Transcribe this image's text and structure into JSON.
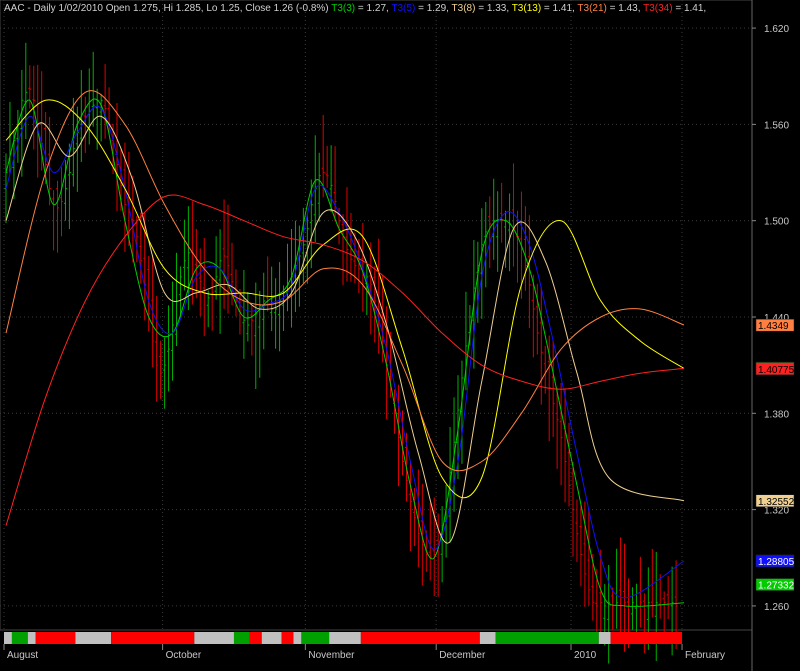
{
  "chart_data": {
    "type": "line",
    "title": {
      "prefix": "AAC - Daily 1/02/2010 Open 1.275, Hi 1.285, Lo 1.25, Close 1.26 (-0.8%)",
      "items": [
        {
          "label": "T3(3)",
          "value": "= 1.27",
          "color": "#00cc00"
        },
        {
          "label": "T3(5)",
          "value": "= 1.29",
          "color": "#1010ff"
        },
        {
          "label": "T3(8)",
          "value": "= 1.33",
          "color": "#f0d090"
        },
        {
          "label": "T3(13)",
          "value": "= 1.41",
          "color": "#ffff00"
        },
        {
          "label": "T3(21)",
          "value": "= 1.43",
          "color": "#ff8040"
        },
        {
          "label": "T3(34)",
          "value": "= 1.41",
          "color": "#ff2020"
        }
      ]
    },
    "ylim": [
      1.245,
      1.635
    ],
    "y_ticks": [
      "1.620",
      "1.560",
      "1.500",
      "1.440",
      "1.380",
      "1.320",
      "1.260"
    ],
    "x_months": [
      {
        "label": "August",
        "bar": 0
      },
      {
        "label": "October",
        "bar": 40
      },
      {
        "label": "November",
        "bar": 76
      },
      {
        "label": "December",
        "bar": 109
      },
      {
        "label": "2010",
        "bar": 143
      },
      {
        "label": "February",
        "bar": 171
      }
    ],
    "bar_count": 172,
    "close": [
      1.53,
      1.542,
      1.55,
      1.56,
      1.575,
      1.58,
      1.582,
      1.575,
      1.56,
      1.548,
      1.535,
      1.52,
      1.51,
      1.508,
      1.512,
      1.52,
      1.53,
      1.545,
      1.555,
      1.56,
      1.565,
      1.568,
      1.572,
      1.575,
      1.575,
      1.57,
      1.56,
      1.548,
      1.535,
      1.522,
      1.51,
      1.505,
      1.5,
      1.49,
      1.475,
      1.46,
      1.442,
      1.425,
      1.41,
      1.405,
      1.41,
      1.42,
      1.435,
      1.45,
      1.465,
      1.475,
      1.48,
      1.48,
      1.472,
      1.462,
      1.455,
      1.452,
      1.455,
      1.465,
      1.475,
      1.478,
      1.472,
      1.462,
      1.45,
      1.443,
      1.438,
      1.435,
      1.438,
      1.442,
      1.447,
      1.45,
      1.448,
      1.445,
      1.445,
      1.45,
      1.455,
      1.46,
      1.465,
      1.472,
      1.478,
      1.485,
      1.495,
      1.51,
      1.52,
      1.528,
      1.53,
      1.528,
      1.522,
      1.512,
      1.5,
      1.49,
      1.482,
      1.476,
      1.472,
      1.47,
      1.468,
      1.465,
      1.46,
      1.45,
      1.438,
      1.425,
      1.41,
      1.395,
      1.38,
      1.365,
      1.35,
      1.338,
      1.325,
      1.315,
      1.305,
      1.298,
      1.292,
      1.29,
      1.292,
      1.298,
      1.31,
      1.325,
      1.343,
      1.362,
      1.382,
      1.402,
      1.422,
      1.44,
      1.458,
      1.472,
      1.485,
      1.493,
      1.498,
      1.5,
      1.5,
      1.5,
      1.5,
      1.498,
      1.495,
      1.49,
      1.482,
      1.472,
      1.46,
      1.445,
      1.43,
      1.418,
      1.406,
      1.396,
      1.386,
      1.376,
      1.365,
      1.35,
      1.335,
      1.32,
      1.305,
      1.292,
      1.28,
      1.27,
      1.262,
      1.26,
      1.262,
      1.26,
      1.262,
      1.26,
      1.262,
      1.26,
      1.262,
      1.26,
      1.262,
      1.26,
      1.262,
      1.26,
      1.262,
      1.26,
      1.262,
      1.26,
      1.262,
      1.26,
      1.262,
      1.26
    ],
    "series": [
      {
        "name": "T3(3)",
        "color": "#00cc00",
        "last_value": "1.27332",
        "values": [
          [
            0,
            1.53
          ],
          [
            6,
            1.575
          ],
          [
            12,
            1.51
          ],
          [
            18,
            1.56
          ],
          [
            24,
            1.572
          ],
          [
            30,
            1.5
          ],
          [
            36,
            1.44
          ],
          [
            42,
            1.43
          ],
          [
            48,
            1.47
          ],
          [
            54,
            1.47
          ],
          [
            60,
            1.44
          ],
          [
            66,
            1.45
          ],
          [
            72,
            1.465
          ],
          [
            78,
            1.525
          ],
          [
            84,
            1.495
          ],
          [
            90,
            1.468
          ],
          [
            96,
            1.41
          ],
          [
            102,
            1.335
          ],
          [
            108,
            1.29
          ],
          [
            114,
            1.37
          ],
          [
            120,
            1.48
          ],
          [
            126,
            1.5
          ],
          [
            132,
            1.47
          ],
          [
            138,
            1.405
          ],
          [
            144,
            1.335
          ],
          [
            150,
            1.27
          ],
          [
            156,
            1.26
          ],
          [
            171,
            1.262
          ]
        ]
      },
      {
        "name": "T3(5)",
        "color": "#1010ff",
        "last_value": "1.28805",
        "values": [
          [
            0,
            1.52
          ],
          [
            6,
            1.565
          ],
          [
            12,
            1.53
          ],
          [
            18,
            1.555
          ],
          [
            24,
            1.57
          ],
          [
            30,
            1.52
          ],
          [
            36,
            1.45
          ],
          [
            42,
            1.43
          ],
          [
            48,
            1.465
          ],
          [
            54,
            1.47
          ],
          [
            60,
            1.445
          ],
          [
            66,
            1.448
          ],
          [
            72,
            1.46
          ],
          [
            78,
            1.52
          ],
          [
            84,
            1.505
          ],
          [
            90,
            1.47
          ],
          [
            96,
            1.42
          ],
          [
            102,
            1.35
          ],
          [
            108,
            1.295
          ],
          [
            114,
            1.35
          ],
          [
            120,
            1.465
          ],
          [
            126,
            1.505
          ],
          [
            132,
            1.485
          ],
          [
            138,
            1.425
          ],
          [
            144,
            1.355
          ],
          [
            150,
            1.29
          ],
          [
            156,
            1.265
          ],
          [
            171,
            1.288
          ]
        ]
      },
      {
        "name": "T3(8)",
        "color": "#f0d090",
        "last_value": "1.32552",
        "values": [
          [
            0,
            1.5
          ],
          [
            8,
            1.56
          ],
          [
            16,
            1.54
          ],
          [
            24,
            1.565
          ],
          [
            32,
            1.525
          ],
          [
            40,
            1.455
          ],
          [
            48,
            1.455
          ],
          [
            56,
            1.46
          ],
          [
            64,
            1.445
          ],
          [
            72,
            1.455
          ],
          [
            80,
            1.505
          ],
          [
            88,
            1.49
          ],
          [
            96,
            1.435
          ],
          [
            104,
            1.355
          ],
          [
            112,
            1.3
          ],
          [
            120,
            1.4
          ],
          [
            128,
            1.495
          ],
          [
            136,
            1.475
          ],
          [
            144,
            1.405
          ],
          [
            152,
            1.34
          ],
          [
            171,
            1.3255
          ]
        ]
      },
      {
        "name": "T3(13)",
        "color": "#ffff00",
        "last_value": "1.40817",
        "values": [
          [
            0,
            1.55
          ],
          [
            10,
            1.575
          ],
          [
            20,
            1.56
          ],
          [
            30,
            1.52
          ],
          [
            40,
            1.47
          ],
          [
            50,
            1.455
          ],
          [
            60,
            1.455
          ],
          [
            70,
            1.455
          ],
          [
            80,
            1.485
          ],
          [
            90,
            1.49
          ],
          [
            100,
            1.42
          ],
          [
            110,
            1.34
          ],
          [
            120,
            1.34
          ],
          [
            130,
            1.46
          ],
          [
            140,
            1.5
          ],
          [
            150,
            1.45
          ],
          [
            160,
            1.425
          ],
          [
            171,
            1.408
          ]
        ]
      },
      {
        "name": "T3(21)",
        "color": "#ff8040",
        "last_value": "1.4349",
        "values": [
          [
            0,
            1.43
          ],
          [
            10,
            1.53
          ],
          [
            20,
            1.58
          ],
          [
            30,
            1.56
          ],
          [
            40,
            1.51
          ],
          [
            50,
            1.47
          ],
          [
            60,
            1.45
          ],
          [
            70,
            1.45
          ],
          [
            80,
            1.47
          ],
          [
            90,
            1.46
          ],
          [
            100,
            1.41
          ],
          [
            110,
            1.35
          ],
          [
            120,
            1.35
          ],
          [
            130,
            1.38
          ],
          [
            140,
            1.42
          ],
          [
            150,
            1.44
          ],
          [
            160,
            1.445
          ],
          [
            171,
            1.435
          ]
        ]
      },
      {
        "name": "T3(34)",
        "color": "#ff2020",
        "last_value": "1.40775",
        "values": [
          [
            0,
            1.31
          ],
          [
            10,
            1.39
          ],
          [
            20,
            1.45
          ],
          [
            30,
            1.49
          ],
          [
            40,
            1.515
          ],
          [
            50,
            1.51
          ],
          [
            60,
            1.5
          ],
          [
            70,
            1.49
          ],
          [
            80,
            1.485
          ],
          [
            90,
            1.475
          ],
          [
            100,
            1.455
          ],
          [
            110,
            1.43
          ],
          [
            120,
            1.41
          ],
          [
            130,
            1.4
          ],
          [
            140,
            1.395
          ],
          [
            150,
            1.4
          ],
          [
            160,
            1.405
          ],
          [
            171,
            1.408
          ]
        ]
      }
    ],
    "price_labels": [
      {
        "value": "1.4349",
        "color": "#ff8040",
        "text_color": "#000000"
      },
      {
        "value": "1.40817",
        "color": "#ffff00",
        "text_color": "#000000"
      },
      {
        "value": "1.40775",
        "color": "#ff2020",
        "text_color": "#000000"
      },
      {
        "value": "1.32552",
        "color": "#f0d090",
        "text_color": "#000000"
      },
      {
        "value": "1.28805",
        "color": "#1010ff",
        "text_color": "#ffffff"
      },
      {
        "value": "1.27332",
        "color": "#00cc00",
        "text_color": "#ffffff"
      }
    ],
    "ribbon": [
      [
        "#c0c0c0",
        0,
        2
      ],
      [
        "#00a000",
        2,
        6
      ],
      [
        "#c0c0c0",
        6,
        8
      ],
      [
        "#ff0000",
        8,
        18
      ],
      [
        "#c0c0c0",
        18,
        27
      ],
      [
        "#ff0000",
        27,
        48
      ],
      [
        "#c0c0c0",
        48,
        58
      ],
      [
        "#00a000",
        58,
        62
      ],
      [
        "#ff0000",
        62,
        65
      ],
      [
        "#c0c0c0",
        65,
        70
      ],
      [
        "#ff0000",
        70,
        73
      ],
      [
        "#c0c0c0",
        73,
        75
      ],
      [
        "#00a000",
        75,
        82
      ],
      [
        "#c0c0c0",
        82,
        90
      ],
      [
        "#ff0000",
        90,
        120
      ],
      [
        "#c0c0c0",
        120,
        124
      ],
      [
        "#00a000",
        124,
        150
      ],
      [
        "#c0c0c0",
        150,
        153
      ],
      [
        "#ff0000",
        153,
        171
      ]
    ]
  }
}
